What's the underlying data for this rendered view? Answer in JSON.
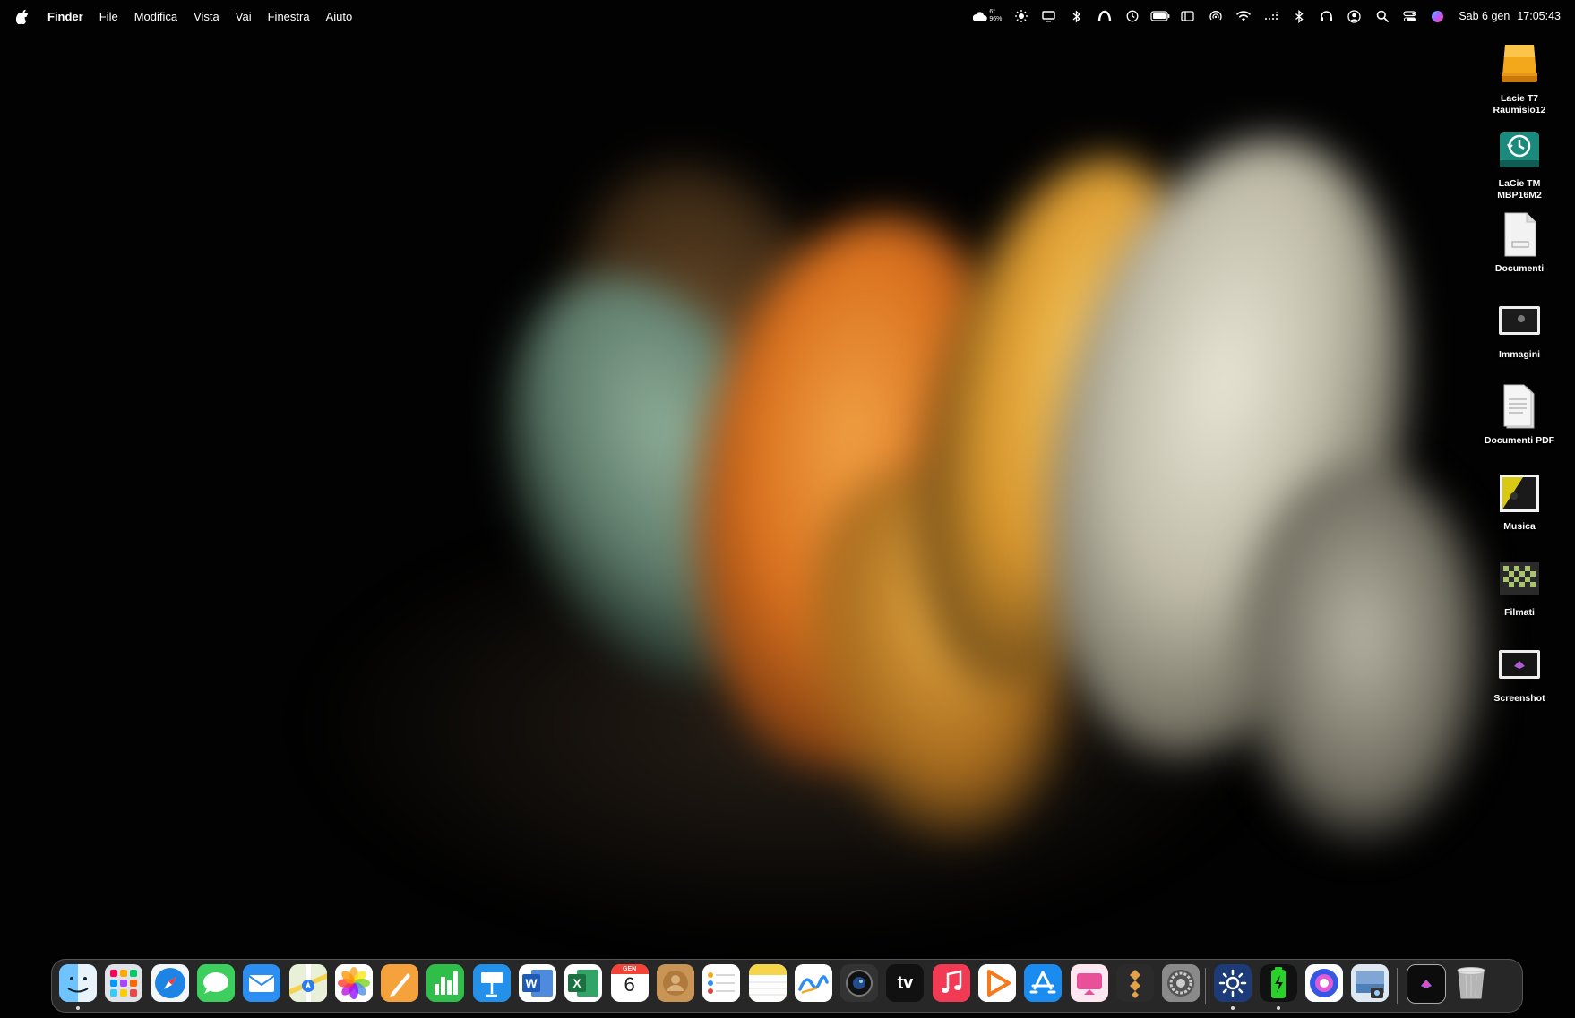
{
  "menubar": {
    "apple_icon": "apple-logo-icon",
    "app_name": "Finder",
    "menus": [
      "File",
      "Modifica",
      "Vista",
      "Vai",
      "Finestra",
      "Aiuto"
    ],
    "weather": {
      "temp": "6°",
      "humidity": "96%"
    },
    "status_icons": [
      "brightness-icon",
      "display-icon",
      "bluetooth-alt-icon",
      "arc-icon",
      "clock-icon",
      "battery-icon",
      "sidebar-icon",
      "airdrop-icon",
      "wifi-icon",
      "dots-icon",
      "bluetooth-icon",
      "headphones-icon",
      "user-icon",
      "search-icon",
      "control-center-icon",
      "siri-icon"
    ],
    "date": "Sab 6 gen",
    "time": "17:05:43"
  },
  "desktop_icons": [
    {
      "label_line1": "Lacie T7",
      "label_line2": "Raumisio12",
      "icon": "external-drive-icon",
      "color": "#f1a21a"
    },
    {
      "label_line1": "LaCie TM",
      "label_line2": "MBP16M2",
      "icon": "time-machine-drive-icon",
      "color": "#1f9c8c"
    },
    {
      "label_line1": "Documenti",
      "label_line2": "",
      "icon": "document-icon",
      "color": "#e9e9e9"
    },
    {
      "label_line1": "Immagini",
      "label_line2": "",
      "icon": "images-folder-icon",
      "color": "#d8d8d8"
    },
    {
      "label_line1": "Documenti PDF",
      "label_line2": "",
      "icon": "pdf-document-icon",
      "color": "#e9e9e9"
    },
    {
      "label_line1": "Musica",
      "label_line2": "",
      "icon": "music-folder-icon",
      "color": "#e2d21a"
    },
    {
      "label_line1": "Filmati",
      "label_line2": "",
      "icon": "movies-folder-icon",
      "color": "#8fb35a"
    },
    {
      "label_line1": "Screenshot",
      "label_line2": "",
      "icon": "screenshot-folder-icon",
      "color": "#d8d8d8"
    }
  ],
  "dock": {
    "apps": [
      {
        "name": "Finder",
        "icon": "finder-icon",
        "color": "#3a8ee6",
        "running": true
      },
      {
        "name": "Launchpad",
        "icon": "launchpad-icon",
        "color": "#9aa3ad",
        "running": false
      },
      {
        "name": "Safari",
        "icon": "safari-icon",
        "color": "#1d84e6",
        "running": false
      },
      {
        "name": "Messaggi",
        "icon": "messages-icon",
        "color": "#36c75a",
        "running": false
      },
      {
        "name": "Mail",
        "icon": "mail-icon",
        "color": "#2b8ef0",
        "running": false
      },
      {
        "name": "Mappe",
        "icon": "maps-icon",
        "color": "#6cc26d",
        "running": false
      },
      {
        "name": "Foto",
        "icon": "photos-icon",
        "color": "#ffffff",
        "running": false
      },
      {
        "name": "Pages",
        "icon": "pages-icon",
        "color": "#f39b2b",
        "running": false
      },
      {
        "name": "Numbers",
        "icon": "numbers-icon",
        "color": "#2fbe4a",
        "running": false
      },
      {
        "name": "Keynote",
        "icon": "keynote-icon",
        "color": "#2391ea",
        "running": false
      },
      {
        "name": "Word",
        "icon": "word-icon",
        "color": "#2b5fb8",
        "running": false
      },
      {
        "name": "Excel",
        "icon": "excel-icon",
        "color": "#1e7a43",
        "running": false
      },
      {
        "name": "Calendario",
        "icon": "calendar-icon",
        "color": "#ffffff",
        "month": "GEN",
        "day": "6",
        "running": false
      },
      {
        "name": "Contatti",
        "icon": "contacts-icon",
        "color": "#c28c4a",
        "running": false
      },
      {
        "name": "Promemoria",
        "icon": "reminders-icon",
        "color": "#ffffff",
        "running": false
      },
      {
        "name": "Note",
        "icon": "notes-icon",
        "color": "#f7d54a",
        "running": false
      },
      {
        "name": "Freeform",
        "icon": "freeform-icon",
        "color": "#ffffff",
        "running": false
      },
      {
        "name": "Camera",
        "icon": "camera-icon",
        "color": "#2a2a2a",
        "running": false
      },
      {
        "name": "Apple TV",
        "icon": "appletv-icon",
        "color": "#111111",
        "label": "tv",
        "running": false
      },
      {
        "name": "Musica",
        "icon": "music-icon",
        "color": "#f23c55",
        "running": false
      },
      {
        "name": "Infuse",
        "icon": "infuse-icon",
        "color": "#ffffff",
        "running": false
      },
      {
        "name": "App Store",
        "icon": "appstore-icon",
        "color": "#1a8cf0",
        "running": false
      },
      {
        "name": "Gemini",
        "icon": "gemini-icon",
        "color": "#ea4f9a",
        "running": false
      },
      {
        "name": "Frame",
        "icon": "frame-app-icon",
        "color": "#2b2b2b",
        "running": false
      },
      {
        "name": "Impostazioni di Sistema",
        "icon": "system-settings-icon",
        "color": "#8a8a8a",
        "running": false
      },
      {
        "name": "Brightness",
        "icon": "brightness-app-icon",
        "color": "#1c3b78",
        "running": true
      },
      {
        "name": "Battery Monitor",
        "icon": "battery-app-icon",
        "color": "#2ad12a",
        "running": true
      },
      {
        "name": "Grapher",
        "icon": "grapher-icon",
        "color": "#3557e6",
        "running": false
      },
      {
        "name": "Preview",
        "icon": "preview-icon",
        "color": "#b0c6de",
        "running": false
      }
    ],
    "stack": {
      "name": "Screenshot",
      "icon": "screenshot-stack-icon"
    },
    "trash": {
      "name": "Cestino",
      "icon": "trash-icon"
    }
  }
}
